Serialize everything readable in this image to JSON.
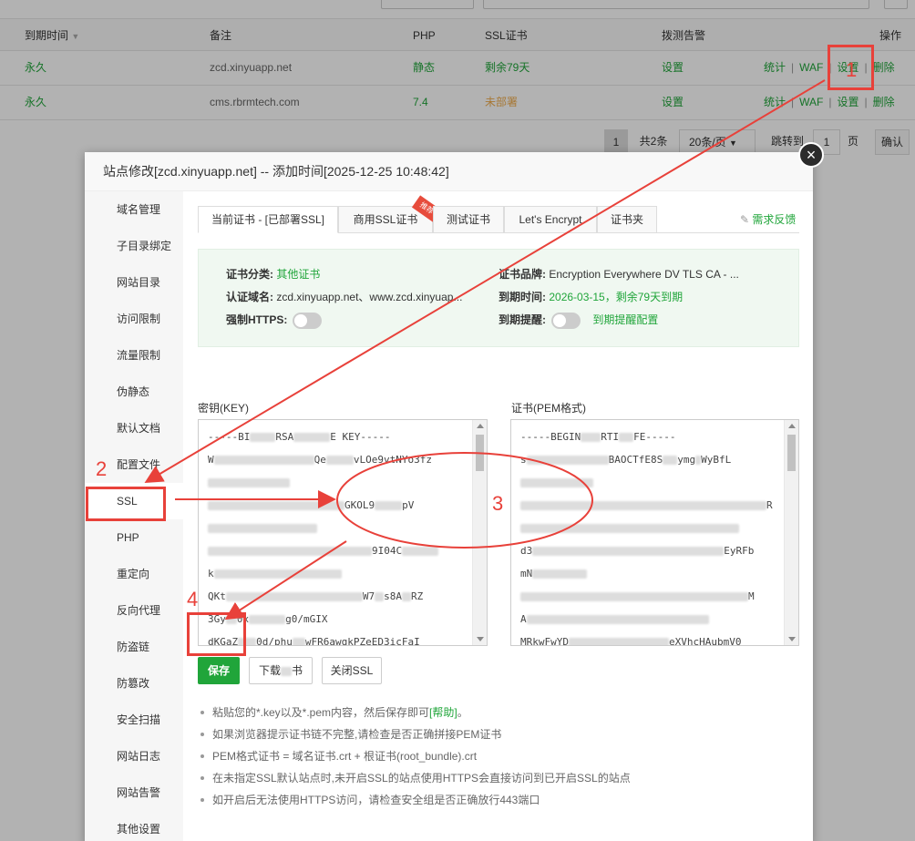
{
  "table": {
    "headers": [
      "到期时间",
      "备注",
      "PHP",
      "SSL证书",
      "拨测告警",
      "操作"
    ],
    "rows": [
      {
        "expire": "永久",
        "note": "zcd.xinyuapp.net",
        "php": "静态",
        "ssl": "剩余79天",
        "alarm": "设置",
        "op_stats": "统计",
        "op_waf": "WAF",
        "op_set": "设置",
        "op_del": "删除"
      },
      {
        "expire": "永久",
        "note": "cms.rbrmtech.com",
        "php": "7.4",
        "ssl": "未部署",
        "alarm": "设置",
        "op_stats": "统计",
        "op_waf": "WAF",
        "op_set": "设置",
        "op_del": "删除"
      }
    ],
    "op_sep": "|"
  },
  "pager": {
    "current": "1",
    "total": "共2条",
    "per_page": "20条/页",
    "jump_label": "跳转到",
    "jump_value": "1",
    "page_unit": "页",
    "confirm": "确认"
  },
  "modal": {
    "title": "站点修改[zcd.xinyuapp.net] -- 添加时间[2025-12-25 10:48:42]",
    "close": "×",
    "sidebar": [
      "域名管理",
      "子目录绑定",
      "网站目录",
      "访问限制",
      "流量限制",
      "伪静态",
      "默认文档",
      "配置文件",
      "SSL",
      "PHP",
      "重定向",
      "反向代理",
      "防盗链",
      "防篡改",
      "安全扫描",
      "网站日志",
      "网站告警",
      "其他设置"
    ],
    "tabs": [
      "当前证书 - [已部署SSL]",
      "商用SSL证书",
      "测试证书",
      "Let's Encrypt",
      "证书夹"
    ],
    "tab_ribbon": "推荐",
    "feedback": "需求反馈",
    "info": {
      "type_label": "证书分类:",
      "type_value": "其他证书",
      "brand_label": "证书品牌:",
      "brand_value": "Encryption Everywhere DV TLS CA - ...",
      "domain_label": "认证域名:",
      "domain_value": "zcd.xinyuapp.net、www.zcd.xinyuap...",
      "expire_label": "到期时间:",
      "expire_value": "2026-03-15，剩余79天到期",
      "https_label": "强制HTTPS:",
      "remind_label": "到期提醒:",
      "remind_link": "到期提醒配置"
    },
    "key_label": "密钥(KEY)",
    "cert_label": "证书(PEM格式)",
    "key_lines": [
      "-----BI",
      "W",
      "",
      "",
      "",
      "",
      "",
      "k",
      "QKt",
      "3Gy",
      "dKGaZ"
    ],
    "key_tails": [
      "RSA",
      "E KEY-----",
      "Qe",
      "vLOe9vtNYo3fz",
      "GKOL9",
      "pV",
      "9I04C",
      "",
      "W7",
      "s8A",
      "RZ",
      "0x",
      "g0",
      "/mGIX",
      "0d/phu",
      "wFR6awqkPZeED3icFaI"
    ],
    "cert_lines": [
      "-----BEGIN",
      "s",
      "",
      "",
      "",
      "d3",
      "mN",
      "",
      "A",
      "MRkwFwYD"
    ],
    "cert_tails": [
      "RTI",
      "FE-----",
      "BA",
      "OCTfE8S",
      "ymg",
      "WyBfL",
      "R",
      "EyRFb",
      "M",
      "eXVhcHAubmV0"
    ],
    "btn_save": "保存",
    "btn_download_a": "下载",
    "btn_download_b": "书",
    "btn_close_ssl": "关闭SSL",
    "tips": [
      "粘贴您的*.key以及*.pem内容，然后保存即可[帮助]。",
      "如果浏览器提示证书链不完整,请检查是否正确拼接PEM证书",
      "PEM格式证书 = 域名证书.crt + 根证书(root_bundle).crt",
      "在未指定SSL默认站点时,未开启SSL的站点使用HTTPS会直接访问到已开启SSL的站点",
      "如开启后无法使用HTTPS访问，请检查安全组是否正确放行443端口"
    ],
    "help_link": "[帮助]"
  },
  "annotations": {
    "n1": "1",
    "n2": "2",
    "n3": "3",
    "n4": "4",
    "color": "#e8413a"
  }
}
